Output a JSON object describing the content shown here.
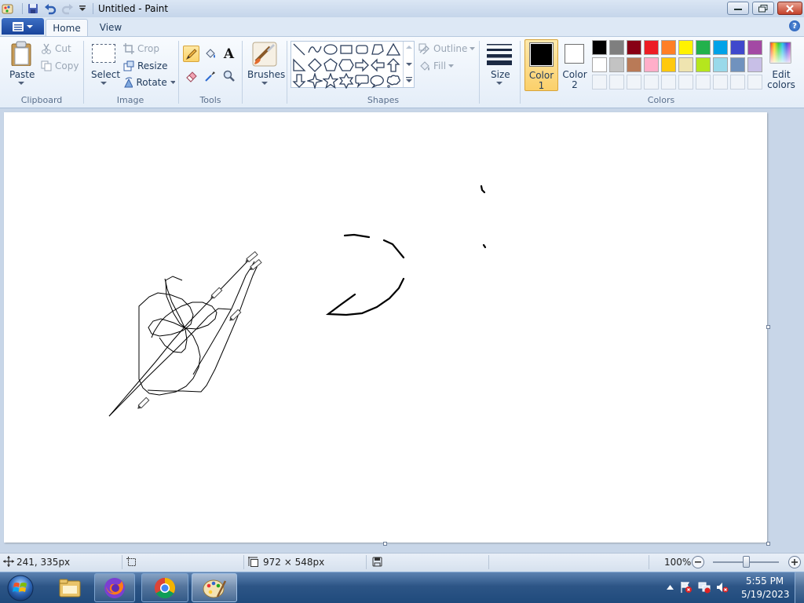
{
  "window": {
    "title": "Untitled - Paint",
    "quick_access": [
      "paint-app-icon",
      "save-icon",
      "undo-icon",
      "redo-icon",
      "customize-qat-icon"
    ],
    "controls": [
      "minimize-icon",
      "restore-icon",
      "close-icon"
    ]
  },
  "tabs": [
    {
      "label": "Home",
      "active": true
    },
    {
      "label": "View",
      "active": false
    }
  ],
  "ribbon": {
    "clipboard": {
      "group_label": "Clipboard",
      "paste": "Paste",
      "cut": "Cut",
      "copy": "Copy"
    },
    "image": {
      "group_label": "Image",
      "select": "Select",
      "crop": "Crop",
      "resize": "Resize",
      "rotate": "Rotate"
    },
    "tools": {
      "group_label": "Tools",
      "items": [
        "pencil-icon",
        "fill-bucket-icon",
        "text-icon",
        "eraser-icon",
        "color-picker-icon",
        "magnifier-icon"
      ],
      "active": "pencil-icon",
      "text_glyph": "A"
    },
    "brushes": {
      "label": "Brushes"
    },
    "shapes": {
      "group_label": "Shapes",
      "outline": "Outline",
      "fill": "Fill",
      "items": [
        "line",
        "curve",
        "oval",
        "rectangle",
        "rounded-rectangle",
        "polygon",
        "triangle",
        "right-triangle",
        "diamond",
        "pentagon",
        "hexagon",
        "right-arrow",
        "left-arrow",
        "up-arrow",
        "down-arrow",
        "four-point-star",
        "five-point-star",
        "six-point-star",
        "rounded-callout",
        "oval-callout",
        "cloud-callout"
      ]
    },
    "size": {
      "label": "Size"
    },
    "color1": {
      "label_1": "Color",
      "label_2": "1",
      "value": "#000000"
    },
    "color2": {
      "label_1": "Color",
      "label_2": "2",
      "value": "#ffffff"
    },
    "colors": {
      "group_label": "Colors",
      "row1": [
        "#000000",
        "#7f7f7f",
        "#880015",
        "#ed1c24",
        "#ff7f27",
        "#fff200",
        "#22b14c",
        "#00a2e8",
        "#3f48cc",
        "#a349a4"
      ],
      "row2": [
        "#ffffff",
        "#c3c3c3",
        "#b97a57",
        "#ffaec9",
        "#ffc90e",
        "#efe4b0",
        "#b5e61d",
        "#99d9ea",
        "#7092be",
        "#c8bfe7"
      ],
      "empty_count": 10
    },
    "edit_colors": {
      "label_1": "Edit",
      "label_2": "colors"
    }
  },
  "status": {
    "position": "241, 335px",
    "canvas_size": "972 × 548px",
    "zoom": "100%",
    "zoom_level": 1.0
  },
  "taskbar": {
    "apps": [
      "file-explorer-icon",
      "firefox-icon",
      "chrome-icon",
      "paint-icon"
    ],
    "time": "5:55 PM",
    "date": "5/19/2023"
  }
}
